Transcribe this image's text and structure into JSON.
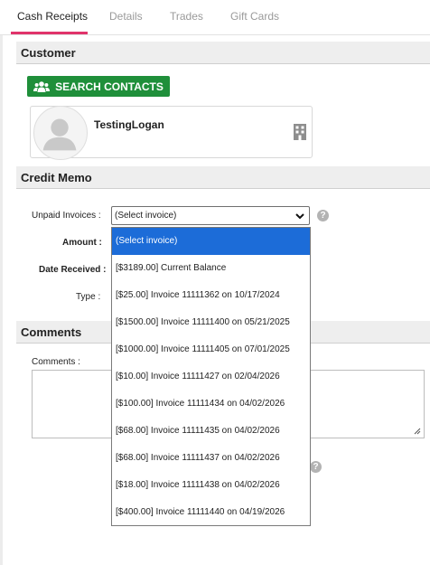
{
  "tabs": [
    {
      "label": "Cash Receipts",
      "active": true
    },
    {
      "label": "Details",
      "active": false
    },
    {
      "label": "Trades",
      "active": false
    },
    {
      "label": "Gift Cards",
      "active": false
    }
  ],
  "customer": {
    "header": "Customer",
    "search_button": "SEARCH CONTACTS",
    "contact_name": "TestingLogan"
  },
  "credit_memo": {
    "header": "Credit Memo",
    "unpaid_invoices_label": "Unpaid Invoices :",
    "unpaid_invoices_value": "(Select invoice)",
    "amount_label": "Amount :",
    "date_received_label": "Date Received :",
    "type_label": "Type :"
  },
  "comments": {
    "header": "Comments",
    "field_label": "Comments :"
  },
  "dropdown": {
    "options": [
      "(Select invoice)",
      "[$3189.00] Current Balance",
      "[$25.00] Invoice 11111362 on 10/17/2024",
      "[$1500.00] Invoice 11111400 on 05/21/2025",
      "[$1000.00] Invoice 11111405 on 07/01/2025",
      "[$10.00] Invoice 11111427 on 02/04/2026",
      "[$100.00] Invoice 11111434 on 04/02/2026",
      "[$68.00] Invoice 11111435 on 04/02/2026",
      "[$68.00] Invoice 11111437 on 04/02/2026",
      "[$18.00] Invoice 11111438 on 04/02/2026",
      "[$400.00] Invoice 11111440 on 04/19/2026"
    ],
    "selected_index": 0
  },
  "help_icon_glyph": "?",
  "icons": [
    "users-icon",
    "avatar-placeholder-icon",
    "building-icon",
    "chevron-down-icon",
    "help-icon",
    "resize-grip-icon"
  ],
  "colors": {
    "accent_tab": "#e0346b",
    "search_button": "#1f8f3a",
    "selected_option": "#1c6cd8"
  }
}
